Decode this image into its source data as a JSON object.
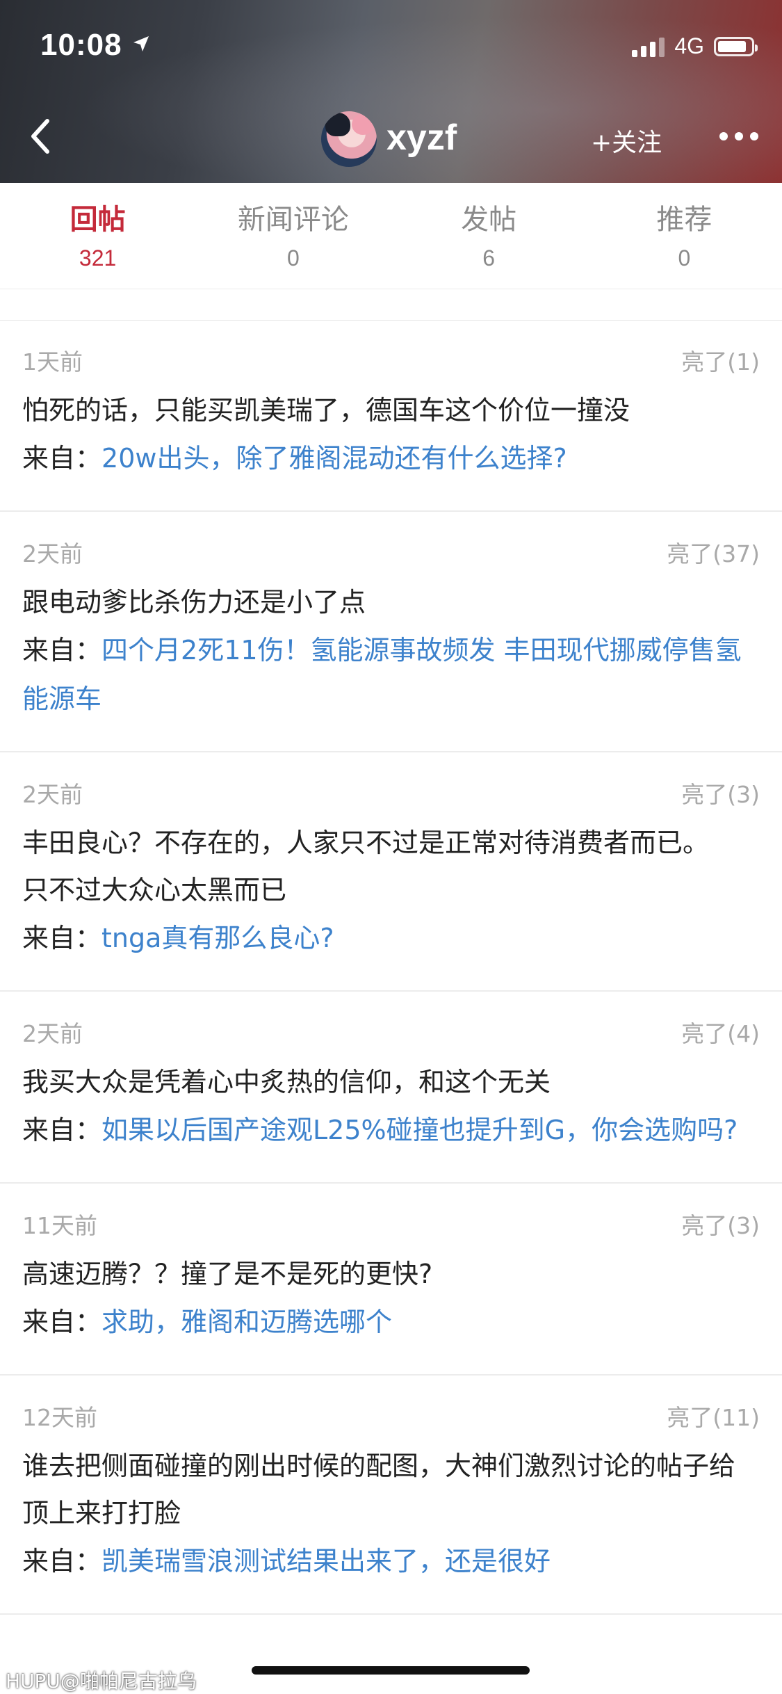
{
  "status_bar": {
    "time": "10:08",
    "network": "4G",
    "battery_level": 0.85,
    "signal_bars": 3
  },
  "header": {
    "username": "xyzf",
    "follow_label": "+关注"
  },
  "tabs": [
    {
      "label": "回帖",
      "count": "321"
    },
    {
      "label": "新闻评论",
      "count": "0"
    },
    {
      "label": "发帖",
      "count": "6"
    },
    {
      "label": "推荐",
      "count": "0"
    }
  ],
  "source_prefix": "来自：",
  "posts": [
    {
      "time": "1天前",
      "likes": "亮了(1)",
      "content": "怕死的话，只能买凯美瑞了，德国车这个价位一撞没",
      "source_title": "20w出头，除了雅阁混动还有什么选择?"
    },
    {
      "time": "2天前",
      "likes": "亮了(37)",
      "content": "跟电动爹比杀伤力还是小了点",
      "source_title": "四个月2死11伤！氢能源事故频发 丰田现代挪威停售氢能源车"
    },
    {
      "time": "2天前",
      "likes": "亮了(3)",
      "content": "丰田良心？不存在的，人家只不过是正常对待消费者而已。\n只不过大众心太黑而已",
      "source_title": "tnga真有那么良心?"
    },
    {
      "time": "2天前",
      "likes": "亮了(4)",
      "content": "我买大众是凭着心中炙热的信仰，和这个无关",
      "source_title": "如果以后国产途观L25%碰撞也提升到G，你会选购吗?"
    },
    {
      "time": "11天前",
      "likes": "亮了(3)",
      "content": "高速迈腾？？撞了是不是死的更快?",
      "source_title": "求助，雅阁和迈腾选哪个"
    },
    {
      "time": "12天前",
      "likes": "亮了(11)",
      "content": "谁去把侧面碰撞的刚出时候的配图，大神们激烈讨论的帖子给顶上来打打脸",
      "source_title": "凯美瑞雪浪测试结果出来了，还是很好"
    }
  ],
  "watermark": "HUPU@啪帕尼古拉乌"
}
